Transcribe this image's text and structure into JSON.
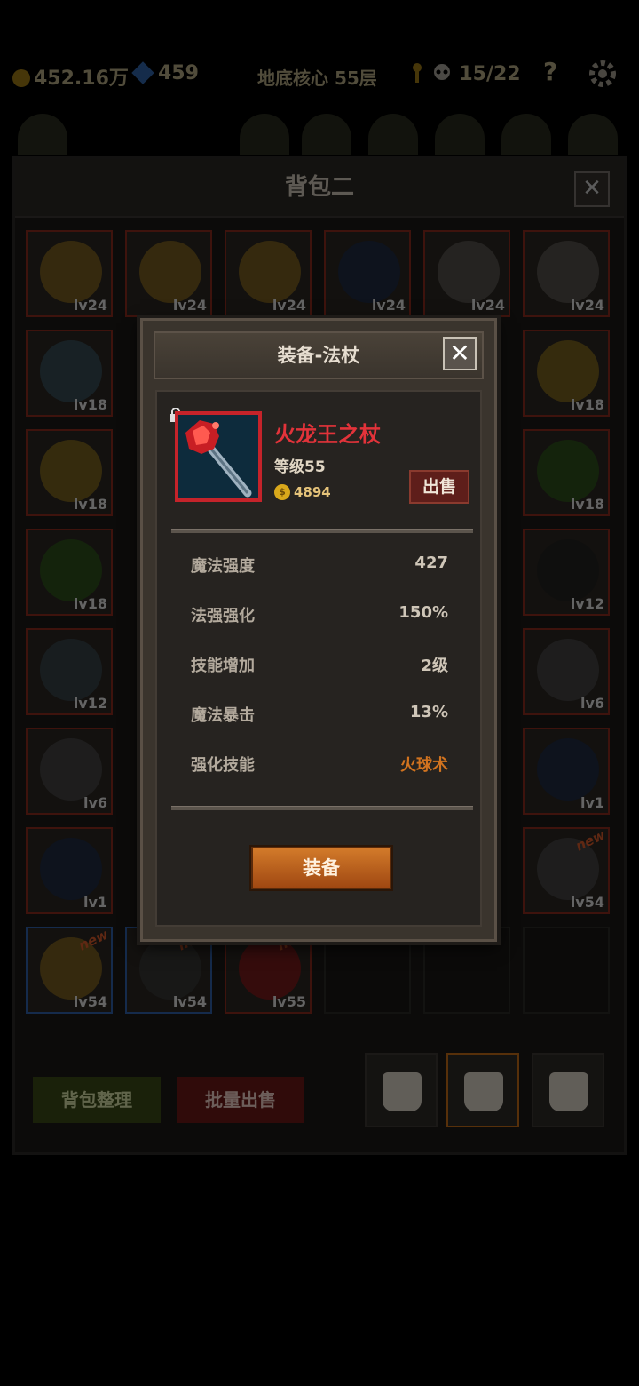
{
  "status_bar": {
    "gold": "452.16万",
    "gems": "459",
    "floor": "地底核心 55层",
    "keys": "15/22",
    "help": "?"
  },
  "bag": {
    "title": "背包二",
    "close": "✕",
    "slots": [
      {
        "lv": "lv24",
        "item": "earring-icon"
      },
      {
        "lv": "lv24",
        "item": "earring-icon"
      },
      {
        "lv": "lv24",
        "item": "earring-icon"
      },
      {
        "lv": "lv24",
        "item": "boots-icon"
      },
      {
        "lv": "lv24",
        "item": "horned-helmet-icon"
      },
      {
        "lv": "lv24",
        "item": "horned-helmet-icon"
      },
      {
        "lv": "lv18",
        "item": "axe-icon"
      },
      {
        "lv": "lv18",
        "item": "ring-icon"
      },
      {
        "lv": "lv18",
        "item": "ring-icon"
      },
      {
        "lv": "lv18",
        "item": "cloak-icon"
      },
      {
        "lv": "lv18",
        "item": "cloak-icon"
      },
      {
        "lv": "lv12",
        "item": "necklace-icon"
      },
      {
        "lv": "lv12",
        "item": "shield-icon"
      },
      {
        "lv": "lv6",
        "item": "helmet-icon"
      },
      {
        "lv": "lv6",
        "item": "helmet-icon"
      },
      {
        "lv": "lv1",
        "item": "boots-icon"
      },
      {
        "lv": "lv1",
        "item": "boots-icon"
      },
      {
        "lv": "lv54",
        "item": "helmet-icon",
        "new": "new"
      },
      {
        "lv": "lv54",
        "item": "earring-icon",
        "new": "new"
      },
      {
        "lv": "lv54",
        "item": "gun-icon",
        "new": "new"
      },
      {
        "lv": "lv55",
        "item": "staff-icon",
        "new": "new"
      }
    ],
    "sort_button": "背包整理",
    "batch_sell_button": "批量出售"
  },
  "modal": {
    "title": "装备-法杖",
    "close": "✕",
    "item": {
      "name": "火龙王之杖",
      "level": "等级55",
      "price": "4894",
      "coin_symbol": "$",
      "icon": "fire-dragon-staff-icon",
      "locked": true
    },
    "sell_button": "出售",
    "stats": [
      {
        "label": "魔法强度",
        "value": "427"
      },
      {
        "label": "法强强化",
        "value": "150%"
      },
      {
        "label": "技能增加",
        "value": "2级"
      },
      {
        "label": "魔法暴击",
        "value": "13%"
      },
      {
        "label": "强化技能",
        "value": "火球术"
      }
    ],
    "equip_button": "装备"
  },
  "colors": {
    "item_name": "#e2333a",
    "skill_value": "#d1731f",
    "price": "#e5c37a",
    "equip_button": "#c46a22"
  }
}
